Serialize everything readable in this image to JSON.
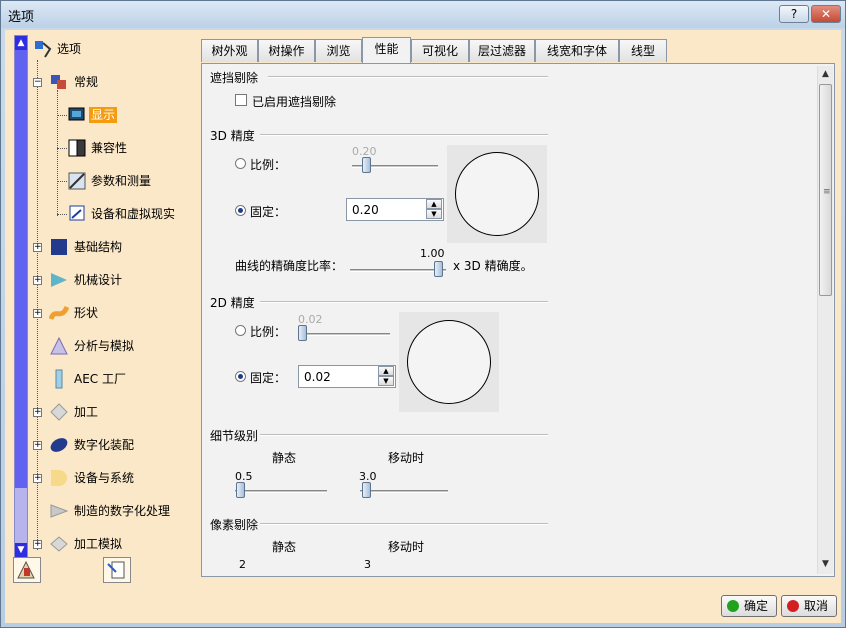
{
  "window": {
    "title": "选项",
    "help_label": "?",
    "close_label": "✕"
  },
  "tree": {
    "items": [
      {
        "label": "选项",
        "icon": "options-tree-icon"
      },
      {
        "label": "常规",
        "icon": "general-icon"
      },
      {
        "label": "显示",
        "icon": "display-icon"
      },
      {
        "label": "兼容性",
        "icon": "compatibility-icon"
      },
      {
        "label": "参数和测量",
        "icon": "parameters-icon"
      },
      {
        "label": "设备和虚拟现实",
        "icon": "devices-icon"
      },
      {
        "label": "基础结构",
        "icon": "infrastructure-icon"
      },
      {
        "label": "机械设计",
        "icon": "mechanical-design-icon"
      },
      {
        "label": "形状",
        "icon": "shape-icon"
      },
      {
        "label": "分析与模拟",
        "icon": "analysis-icon"
      },
      {
        "label": "AEC 工厂",
        "icon": "aec-plant-icon"
      },
      {
        "label": "加工",
        "icon": "machining-icon"
      },
      {
        "label": "数字化装配",
        "icon": "digital-mockup-icon"
      },
      {
        "label": "设备与系统",
        "icon": "equipment-icon"
      },
      {
        "label": "制造的数字化处理",
        "icon": "manufacturing-icon"
      },
      {
        "label": "加工模拟",
        "icon": "machining-sim-icon"
      }
    ]
  },
  "tabs": [
    "树外观",
    "树操作",
    "浏览",
    "性能",
    "可视化",
    "层过滤器",
    "线宽和字体",
    "线型"
  ],
  "active_tab": "性能",
  "occlusion": {
    "title": "遮挡剔除",
    "checkbox_label": "已启用遮挡剔除",
    "checked": false
  },
  "precision3d": {
    "title": "3D 精度",
    "ratio_label": "比例：",
    "ratio_value": "0.20",
    "fixed_label": "固定：",
    "fixed_value": "0.20",
    "curve_label": "曲线的精确度比率：",
    "curve_value": "1.00",
    "curve_suffix": "x 3D 精确度。"
  },
  "precision2d": {
    "title": "2D 精度",
    "ratio_label": "比例：",
    "ratio_value": "0.02",
    "fixed_label": "固定：",
    "fixed_value": "0.02"
  },
  "detail": {
    "title": "细节级别",
    "static_label": "静态",
    "moving_label": "移动时",
    "static_value": "0.5",
    "moving_value": "3.0"
  },
  "pixel": {
    "title": "像素剔除",
    "static_label": "静态",
    "moving_label": "移动时",
    "static_value": "2",
    "moving_value": "3"
  },
  "buttons": {
    "ok": "确定",
    "cancel": "取消"
  },
  "colors": {
    "selected_bg": "#f39c12",
    "panel_bg": "#fbe8c8",
    "ok_dot": "#1fa31f",
    "cancel_dot": "#d22020"
  }
}
